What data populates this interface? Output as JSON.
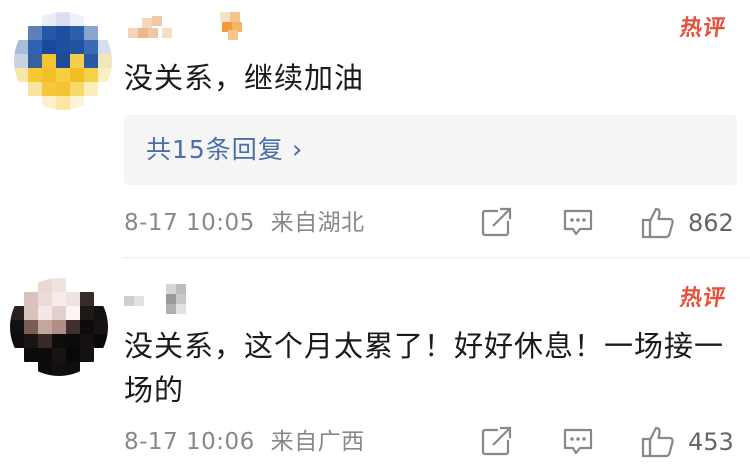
{
  "comments": [
    {
      "username_obscured": true,
      "hot_label": "热评",
      "text": "没关系，继续加油",
      "replies_label": "共15条回复",
      "timestamp": "8-17 10:05",
      "location": "来自湖北",
      "like_count": "862",
      "icons": [
        "share-icon",
        "comment-icon",
        "like-icon"
      ]
    },
    {
      "username_obscured": true,
      "hot_label": "热评",
      "text": "没关系，这个月太累了！好好休息！一场接一场的",
      "timestamp": "8-17 10:06",
      "location": "来自广西",
      "like_count": "453",
      "icons": [
        "share-icon",
        "comment-icon",
        "like-icon"
      ]
    }
  ],
  "colors": {
    "hot": "#e8503a",
    "link": "#4a6ea8",
    "meta": "#888888",
    "text": "#1a1a1a",
    "reply_bg": "#f5f5f5"
  }
}
